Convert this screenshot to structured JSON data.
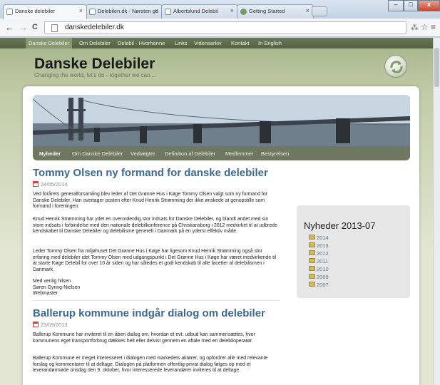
{
  "browser": {
    "tabs": [
      {
        "label": "Danske delebiler",
        "active": true
      },
      {
        "label": "Delebilen.dk - Nørsten go",
        "active": false
      },
      {
        "label": "Albertslund Delebil",
        "active": false
      },
      {
        "label": "Getting Started",
        "active": false
      }
    ],
    "url": "danskedelebiler.dk",
    "close_glyph": "×",
    "back_glyph": "←",
    "forward_glyph": "→",
    "reload_glyph": "C",
    "star_glyph": "☆",
    "menu_glyph": "≡",
    "translate_glyph": "⁂",
    "win_min": "–",
    "win_max": "□",
    "win_close": "x"
  },
  "topnav": {
    "items": [
      "Danske Delebiler",
      "Om Delebiler",
      "Delebil - Hvorhenne",
      "Links",
      "Vidensarkiv",
      "Kontakt",
      "In English"
    ]
  },
  "site": {
    "title": "Danske Delebiler",
    "tagline": "Changing the world, let's do - together we can...."
  },
  "subnav": {
    "items": [
      "Nyheder",
      "Om Danske Delebiler",
      "Vedtægter",
      "Definition af Delebiler",
      "Medlemmer",
      "Bestyrelsen"
    ]
  },
  "posts": [
    {
      "title": "Tommy Olsen ny formand for danske delebiler",
      "date": "24/05/2014",
      "paragraphs": [
        "Ved forårets generalforsamling blev leder af Det Grønne Hus i Køge Tommy Olsen valgt som ny formand for Danske Delebiler. Han overtager posten efter Knud Henrik Strømming der ikke ønskede at genopstille som formand i foreningen.",
        "Knud Henrik Strømming har ydet en overordentlig stor indsats for Danske Delebiler, og blandt andet med sin store indsats i forbindelse med den nationale delebilkonference på Christiansborg i 2012 medvirket til at udbrede kendskabet til Danske Delebiler og delebilisme generelt i Danmark på en yderst effektiv måde.",
        "Leder Tommy Olsen fra miljøhuset Det Grønne Hus i Køge har ligesom Knud Henrik Strømming også stor erfaring med delebiler idet Tommy Olsen med udgangspunkt i Det Grønne Hus i Køge har været medvirkende til at starte Køge Delebil for over 10 år siden og har således et godt kendskab til alle facetter af delebilismen i Danmark.",
        "Med venlig hilsen\nSøren Gyring-Nielsen\nWebmaster"
      ]
    },
    {
      "title": "Ballerup kommune indgår dialog om delebiler",
      "date": "23/09/2013",
      "paragraphs": [
        "Ballerup Kommune har inviteret til en åben dialog om, hvordan et evt. udbud kan sammensættes, hvor kommunens eget transportforbrug dækkes helt eller delvist gennem en aftale med en delebiloperatør.",
        "Ballerup Kommune er meget interesseret i dialogen med markedets aktører, og opfordrer alle med relevante forslag og kommentarer til at deltage. Dialogen på platformen offentlig-privat dialog følges op med et leverandørmøde onsdag den 9. oktober, hvor interesserede leverandører inviteres til at deltage."
      ]
    }
  ],
  "sidebar": {
    "heading": "Nyheder 2013-07",
    "years": [
      "2014",
      "2013",
      "2012",
      "2011",
      "2010",
      "2009",
      "2007"
    ]
  }
}
